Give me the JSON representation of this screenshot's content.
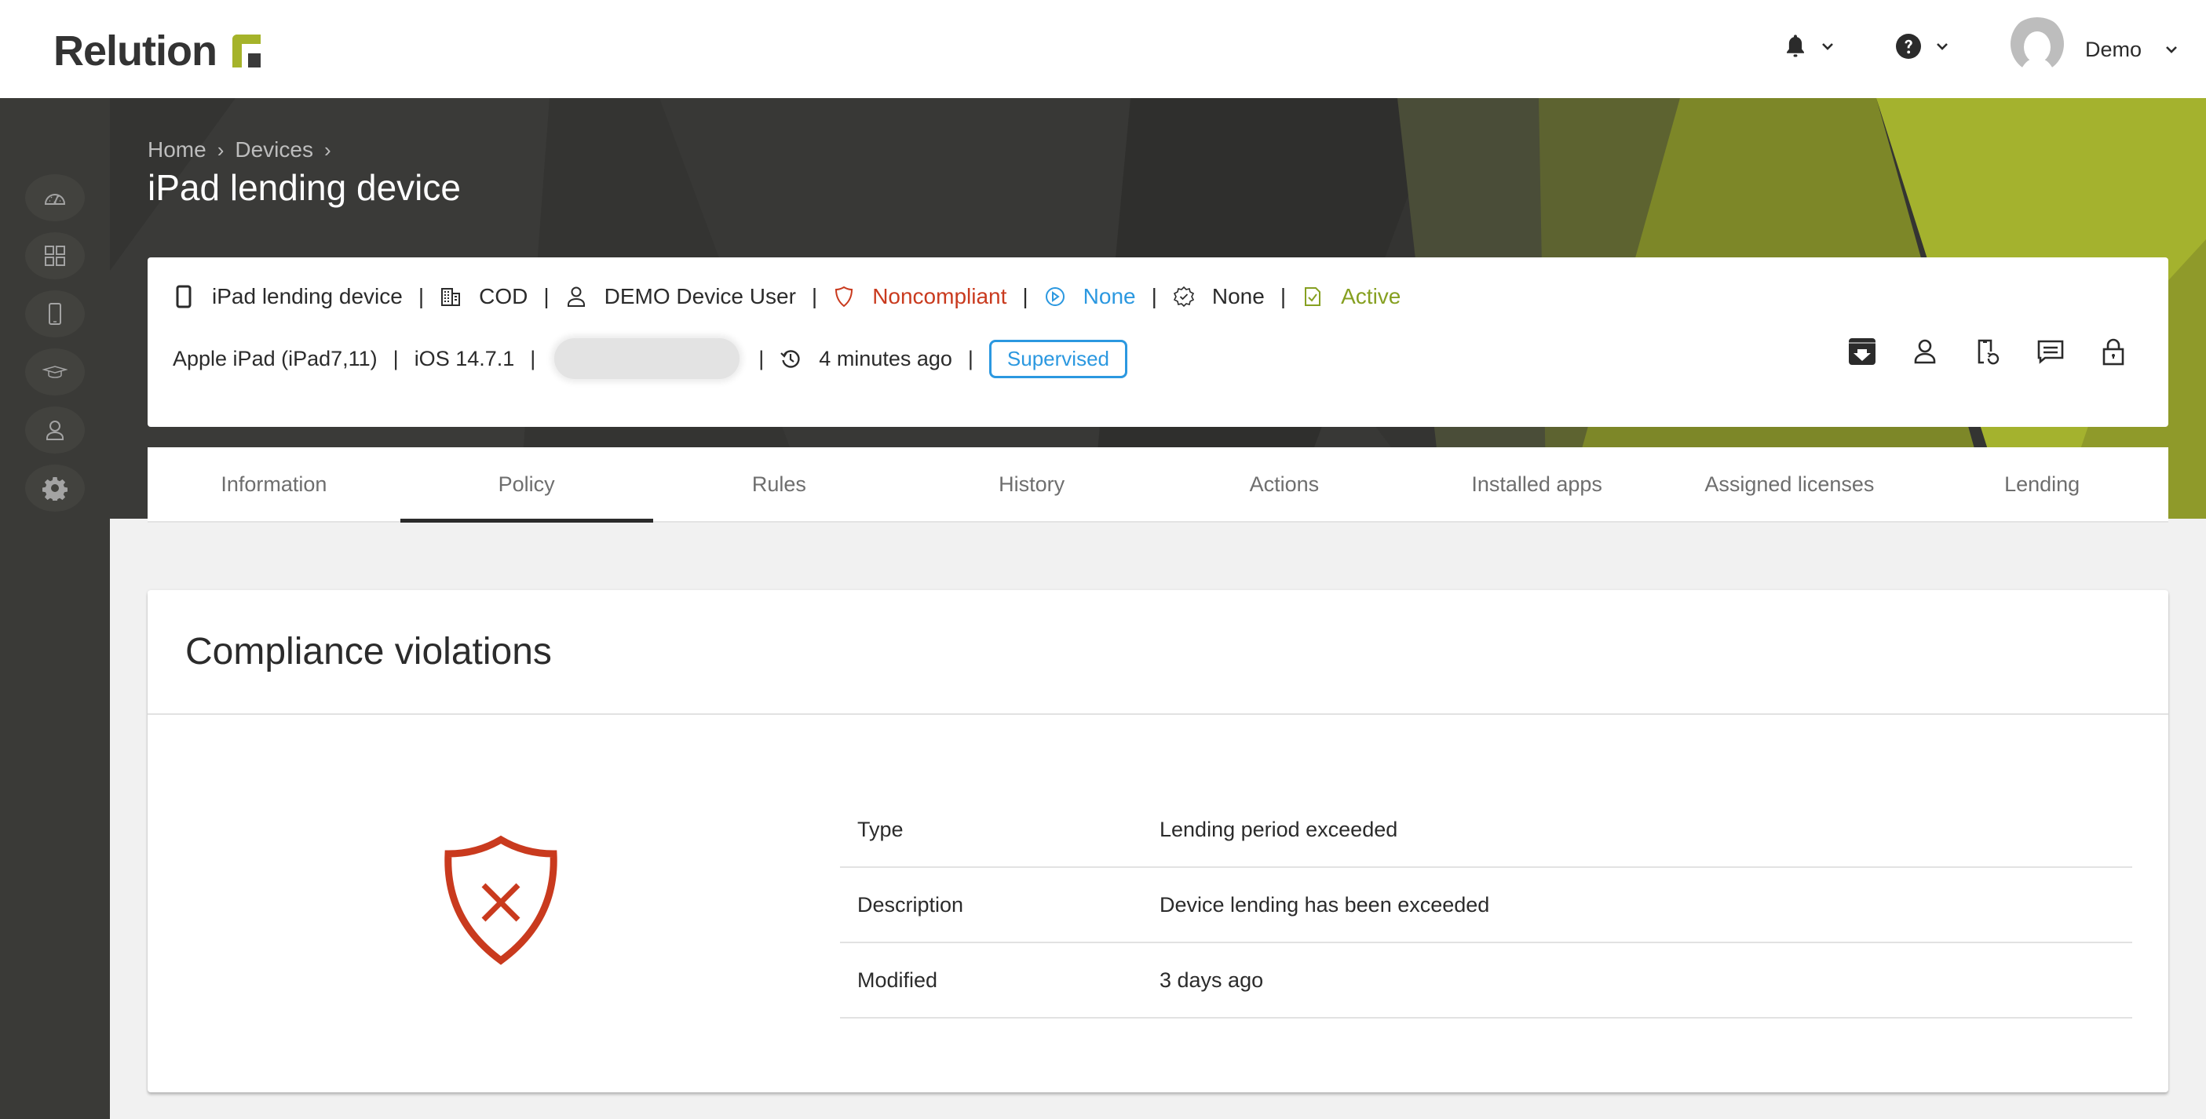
{
  "app": {
    "logo_text": "Relution",
    "brand_colors": {
      "accent_green": "#a5b32a",
      "dark": "#353533",
      "danger": "#c93a1e",
      "info": "#2b98e0",
      "success": "#86a021"
    }
  },
  "topbar": {
    "notifications_icon": "bell-icon",
    "help_icon": "question-circle-icon",
    "user_name": "Demo"
  },
  "sidebar": {
    "items": [
      {
        "name": "dashboard",
        "icon": "speedometer-icon"
      },
      {
        "name": "apps",
        "icon": "grid-icon"
      },
      {
        "name": "devices",
        "icon": "tablet-icon"
      },
      {
        "name": "education",
        "icon": "graduation-cap-icon"
      },
      {
        "name": "users",
        "icon": "user-icon"
      },
      {
        "name": "settings",
        "icon": "gear-icon"
      }
    ]
  },
  "breadcrumb": [
    {
      "label": "Home"
    },
    {
      "label": "Devices"
    }
  ],
  "page_title": "iPad lending device",
  "device": {
    "name": "iPad lending device",
    "ownership": "COD",
    "user": "DEMO Device User",
    "compliance": "Noncompliant",
    "policy_state": "None",
    "config_state": "None",
    "status": "Active",
    "model": "Apple iPad (iPad7,11)",
    "os": "iOS 14.7.1",
    "serial_redacted": "",
    "last_contact": "4 minutes ago",
    "supervised_label": "Supervised",
    "actions": [
      {
        "name": "archive-download",
        "icon": "archive-download-icon"
      },
      {
        "name": "assign-user",
        "icon": "user-icon"
      },
      {
        "name": "refresh-device",
        "icon": "device-refresh-icon"
      },
      {
        "name": "send-message",
        "icon": "message-icon"
      },
      {
        "name": "lock-device",
        "icon": "lock-icon"
      }
    ]
  },
  "tabs": [
    {
      "label": "Information",
      "active": false
    },
    {
      "label": "Policy",
      "active": true
    },
    {
      "label": "Rules",
      "active": false
    },
    {
      "label": "History",
      "active": false
    },
    {
      "label": "Actions",
      "active": false
    },
    {
      "label": "Installed apps",
      "active": false
    },
    {
      "label": "Assigned licenses",
      "active": false
    },
    {
      "label": "Lending",
      "active": false
    }
  ],
  "compliance": {
    "title": "Compliance violations",
    "icon": "shield-x-icon",
    "rows": [
      {
        "label": "Type",
        "value": "Lending period exceeded"
      },
      {
        "label": "Description",
        "value": "Device lending has been exceeded"
      },
      {
        "label": "Modified",
        "value": "3 days ago"
      }
    ]
  }
}
